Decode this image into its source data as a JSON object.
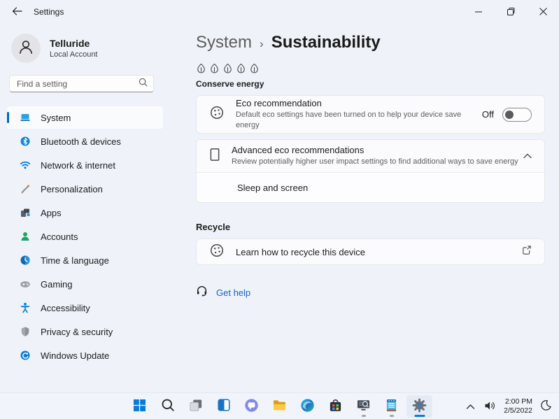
{
  "titlebar": {
    "title": "Settings"
  },
  "sidebar": {
    "user": {
      "name": "Telluride",
      "type": "Local Account"
    },
    "search": {
      "placeholder": "Find a setting"
    },
    "items": [
      {
        "label": "System",
        "icon": "system-icon",
        "selected": true
      },
      {
        "label": "Bluetooth & devices",
        "icon": "bluetooth-icon",
        "selected": false
      },
      {
        "label": "Network & internet",
        "icon": "network-icon",
        "selected": false
      },
      {
        "label": "Personalization",
        "icon": "personalization-icon",
        "selected": false
      },
      {
        "label": "Apps",
        "icon": "apps-icon",
        "selected": false
      },
      {
        "label": "Accounts",
        "icon": "accounts-icon",
        "selected": false
      },
      {
        "label": "Time & language",
        "icon": "time-language-icon",
        "selected": false
      },
      {
        "label": "Gaming",
        "icon": "gaming-icon",
        "selected": false
      },
      {
        "label": "Accessibility",
        "icon": "accessibility-icon",
        "selected": false
      },
      {
        "label": "Privacy & security",
        "icon": "privacy-security-icon",
        "selected": false
      },
      {
        "label": "Windows Update",
        "icon": "windows-update-icon",
        "selected": false
      }
    ]
  },
  "main": {
    "breadcrumb": {
      "parent": "System",
      "separator": "›",
      "current": "Sustainability"
    },
    "conserve": {
      "label": "Conserve energy",
      "leaf_count": 5
    },
    "eco_card": {
      "title": "Eco recommendation",
      "description": "Default eco settings have been turned on to help your device save energy",
      "toggle_label": "Off",
      "toggle_state": "off"
    },
    "advanced_card": {
      "title": "Advanced eco recommendations",
      "description": "Review potentially higher user impact settings to find additional ways to save energy",
      "expanded": true,
      "sub_item": "Sleep and screen"
    },
    "recycle": {
      "header": "Recycle",
      "link_title": "Learn how to recycle this device"
    },
    "get_help": {
      "label": "Get help"
    }
  },
  "taskbar": {
    "icons": [
      "start",
      "search",
      "task-view",
      "widgets",
      "chat",
      "file-explorer",
      "edge",
      "store",
      "quick-assist",
      "notepad",
      "settings"
    ],
    "active_icon": "settings",
    "tray": {
      "time": "2:00 PM",
      "date": "2/5/2022"
    }
  },
  "colors": {
    "accent": "#0067c0",
    "link": "#1a5dbe"
  }
}
